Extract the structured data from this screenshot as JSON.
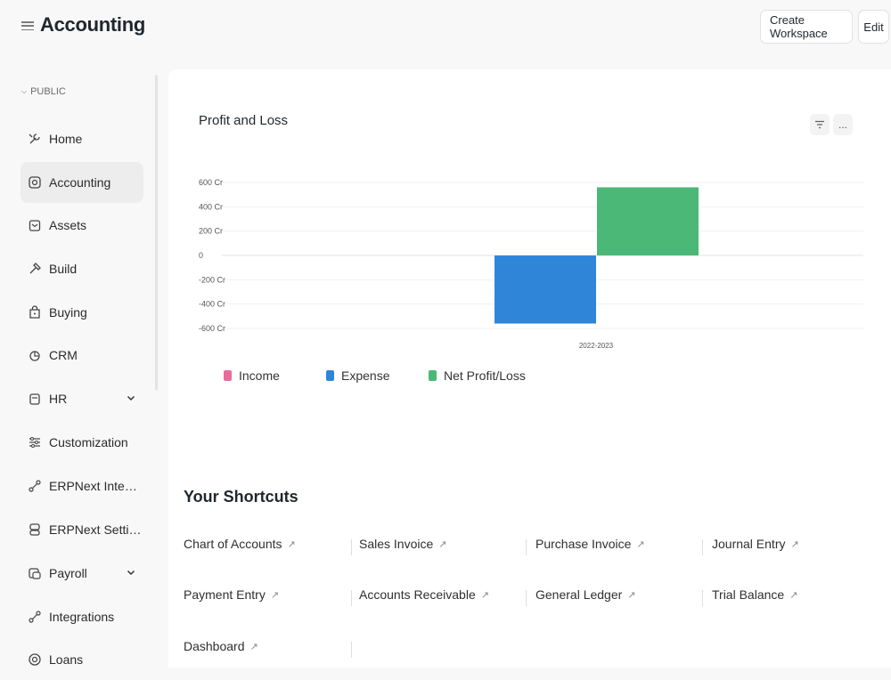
{
  "header": {
    "title": "Accounting",
    "create_workspace_label": "Create Workspace",
    "edit_label": "Edit"
  },
  "sidebar": {
    "section_label": "PUBLIC",
    "items": [
      {
        "label": "Home",
        "icon": "tools-icon"
      },
      {
        "label": "Accounting",
        "icon": "accounting-icon",
        "active": true
      },
      {
        "label": "Assets",
        "icon": "assets-icon"
      },
      {
        "label": "Build",
        "icon": "build-icon"
      },
      {
        "label": "Buying",
        "icon": "buying-icon"
      },
      {
        "label": "CRM",
        "icon": "crm-icon"
      },
      {
        "label": "HR",
        "icon": "hr-icon",
        "expandable": true
      },
      {
        "label": "Customization",
        "icon": "customization-icon"
      },
      {
        "label": "ERPNext Integratio...",
        "icon": "integration-icon"
      },
      {
        "label": "ERPNext Settings",
        "icon": "settings-icon"
      },
      {
        "label": "Payroll",
        "icon": "payroll-icon",
        "expandable": true
      },
      {
        "label": "Integrations",
        "icon": "integrations-icon"
      },
      {
        "label": "Loans",
        "icon": "loans-icon"
      }
    ]
  },
  "chart_card": {
    "title": "Profit and Loss",
    "filter_icon": "filter-icon",
    "more_label": "..."
  },
  "chart_data": {
    "type": "bar",
    "categories": [
      "2022-2023"
    ],
    "series": [
      {
        "name": "Income",
        "values": [
          0
        ],
        "color": "#e86c9a"
      },
      {
        "name": "Expense",
        "values": [
          -560
        ],
        "color": "#2f86d9"
      },
      {
        "name": "Net Profit/Loss",
        "values": [
          560
        ],
        "color": "#4cb877"
      }
    ],
    "y_ticks": [
      "600 Cr",
      "400 Cr",
      "200 Cr",
      "0",
      "-200 Cr",
      "-400 Cr",
      "-600 Cr"
    ],
    "y_tick_values": [
      600,
      400,
      200,
      0,
      -200,
      -400,
      -600
    ],
    "ylim": [
      -600,
      600
    ],
    "unit": "Cr",
    "legend_position": "bottom-left",
    "grid": true
  },
  "shortcuts": {
    "title": "Your Shortcuts",
    "items": [
      "Chart of Accounts",
      "Sales Invoice",
      "Purchase Invoice",
      "Journal Entry",
      "Payment Entry",
      "Accounts Receivable",
      "General Ledger",
      "Trial Balance",
      "Dashboard"
    ],
    "arrow": "↗"
  }
}
